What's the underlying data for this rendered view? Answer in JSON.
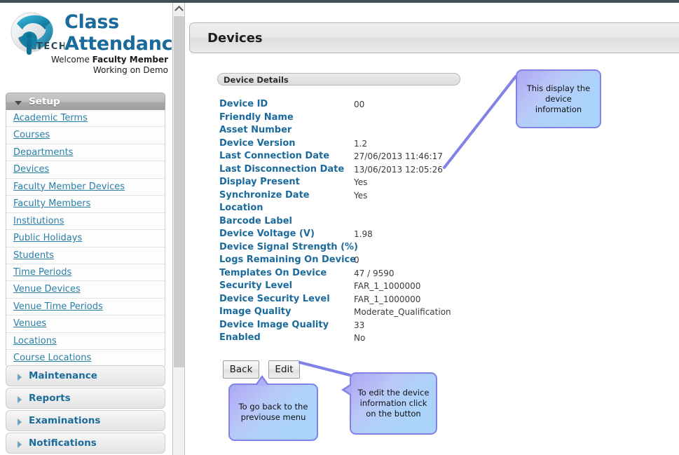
{
  "brand": {
    "logo_icon": "ip-tech-globe-logo",
    "logo_text": "TECH",
    "title_line1": "Class",
    "title_line2": "Attendance",
    "welcome_prefix": "Welcome ",
    "welcome_name": "Faculty Member",
    "working_on": "Working on Demo"
  },
  "sidebar": {
    "groups": [
      {
        "id": "setup",
        "label": "Setup",
        "expanded": true,
        "icon": "chevron-down-icon",
        "items": [
          {
            "label": "Academic Terms"
          },
          {
            "label": "Courses"
          },
          {
            "label": "Departments"
          },
          {
            "label": "Devices"
          },
          {
            "label": "Faculty Member Devices"
          },
          {
            "label": "Faculty Members"
          },
          {
            "label": "Institutions"
          },
          {
            "label": "Public Holidays"
          },
          {
            "label": "Students"
          },
          {
            "label": "Time Periods"
          },
          {
            "label": "Venue Devices"
          },
          {
            "label": "Venue Time Periods"
          },
          {
            "label": "Venues"
          },
          {
            "label": "Locations"
          },
          {
            "label": "Course Locations"
          }
        ]
      },
      {
        "id": "maintenance",
        "label": "Maintenance",
        "expanded": false,
        "icon": "chevron-right-icon"
      },
      {
        "id": "reports",
        "label": "Reports",
        "expanded": false,
        "icon": "chevron-right-icon"
      },
      {
        "id": "examinations",
        "label": "Examinations",
        "expanded": false,
        "icon": "chevron-right-icon"
      },
      {
        "id": "notifications",
        "label": "Notifications",
        "expanded": false,
        "icon": "chevron-right-icon"
      }
    ]
  },
  "scrollbar": {
    "up_arrow_icon": "chevron-up-icon"
  },
  "page": {
    "header_title": "Devices",
    "panel_title": "Device Details"
  },
  "device_details": [
    {
      "label": "Device ID",
      "value": "00"
    },
    {
      "label": "Friendly Name",
      "value": ""
    },
    {
      "label": "Asset Number",
      "value": ""
    },
    {
      "label": "Device Version",
      "value": "1.2"
    },
    {
      "label": "Last Connection Date",
      "value": "27/06/2013 11:46:17"
    },
    {
      "label": "Last Disconnection Date",
      "value": "13/06/2013 12:05:26"
    },
    {
      "label": "Display Present",
      "value": "Yes"
    },
    {
      "label": "Synchronize Date",
      "value": "Yes"
    },
    {
      "label": "Location",
      "value": ""
    },
    {
      "label": "Barcode Label",
      "value": ""
    },
    {
      "label": "Device Voltage (V)",
      "value": "1.98"
    },
    {
      "label": "Device Signal Strength (%)",
      "value": ""
    },
    {
      "label": "Logs Remaining On Device",
      "value": "0"
    },
    {
      "label": "Templates On Device",
      "value": "47 / 9590"
    },
    {
      "label": "Security Level",
      "value": "FAR_1_1000000"
    },
    {
      "label": "Device Security Level",
      "value": "FAR_1_1000000"
    },
    {
      "label": "Image Quality",
      "value": "Moderate_Qualification"
    },
    {
      "label": "Device Image Quality",
      "value": "33"
    },
    {
      "label": "Enabled",
      "value": "No"
    }
  ],
  "buttons": {
    "back": "Back",
    "edit": "Edit"
  },
  "callouts": {
    "info": "This display the device information",
    "back": "To go back to the previouse menu",
    "edit": "To edit the device information click on the button"
  },
  "colors": {
    "link": "#2a7fa8",
    "heading": "#1b6a9c",
    "callout_border": "#8181e8",
    "callout_fill_start": "#a9a9f2",
    "callout_fill_end": "#a8d4fc",
    "top_strip": "#3e4f55"
  }
}
